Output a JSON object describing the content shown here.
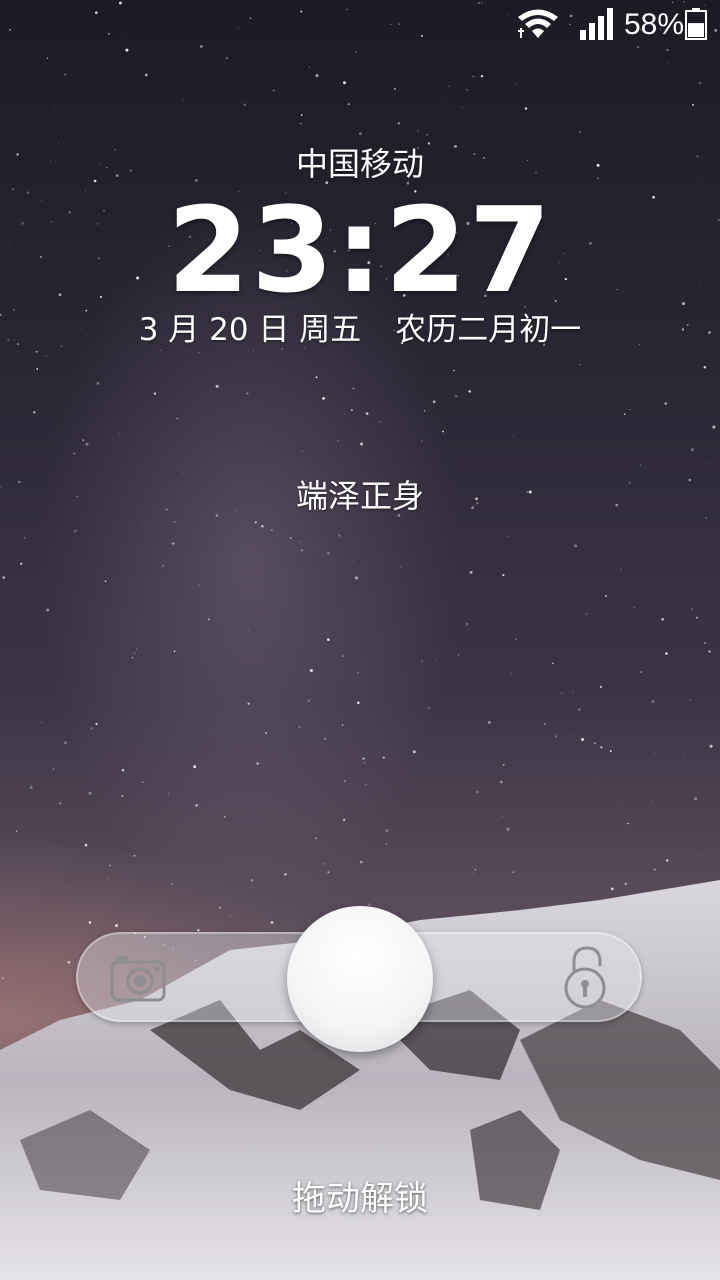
{
  "status_bar": {
    "wifi_icon": "wifi-icon",
    "signal_icon": "cellular-signal-icon",
    "battery_percent": "58%",
    "battery_level": 0.58,
    "battery_icon": "battery-icon"
  },
  "lockscreen": {
    "carrier": "中国移动",
    "time": "23:27",
    "date": "3 月 20 日 周五",
    "lunar_date": "农历二月初一",
    "motto": "端泽正身",
    "unlock_hint": "拖动解锁"
  },
  "slider": {
    "left_icon": "camera-icon",
    "right_icon": "unlock-padlock-icon",
    "knob_color": "#f4f4f6"
  },
  "colors": {
    "text": "#ffffff",
    "sky_top": "#1c1a24",
    "horizon_glow": "#c88c82"
  }
}
